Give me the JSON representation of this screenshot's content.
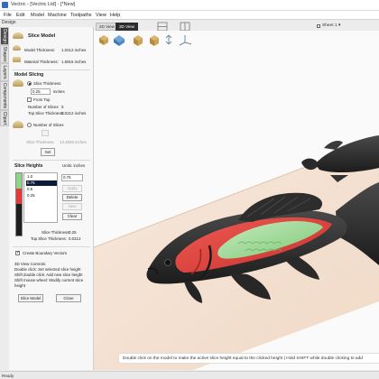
{
  "window": {
    "title": "Vectric - [Vectric Ltd] - [*New]"
  },
  "menu": [
    "File",
    "Edit",
    "Model",
    "Machine",
    "Toolpaths",
    "View",
    "Help"
  ],
  "panel_label": "Design",
  "side_tabs": [
    "Design",
    "Shapes",
    "Layers",
    "Components",
    "Clipart"
  ],
  "slice_model": {
    "heading": "Slice Model",
    "model_thickness_label": "Model Thickness:",
    "model_thickness_value": "1.0212 inches",
    "material_thickness_label": "Material Thickness:",
    "material_thickness_value": "1.5915 inches"
  },
  "model_slicing": {
    "heading": "Model Slicing",
    "slice_thickness_label": "Slice Thickness",
    "slice_thickness_value": "0.25",
    "slice_thickness_unit": "inches",
    "from_top_label": "From Top",
    "number_of_slices_label": "Number of Slices:",
    "number_of_slices_value": "5",
    "top_slice_thickness_label": "Top Slice Thickness:",
    "top_slice_thickness_value": "0.0212 inches",
    "number_of_slices_option": "Number of Slices",
    "slice_thickness_readout_label": "Slice Thickness:",
    "slice_thickness_readout_value": "12.2949 inches",
    "set_button": "Set"
  },
  "slice_heights": {
    "heading": "Slice Heights",
    "units_label": "Units: inches",
    "values": [
      "1.0",
      "0.75",
      "0.5",
      "0.25"
    ],
    "selected_index": 1,
    "edit_value": "0.75",
    "apply_button": "Apply",
    "delete_button": "Delete",
    "new_button": "New",
    "clear_button": "Clear",
    "slice_thickness_label": "Slice Thickness:",
    "slice_thickness_value": "0.25",
    "top_slice_thickness_label": "Top Slice Thickness:",
    "top_slice_thickness_value": "0.0212",
    "bar_colors": [
      "#8ed38e",
      "#e23a3a",
      "#1f1f1f",
      "#1f1f1f"
    ]
  },
  "boundary": {
    "label": "Create Boundary Vectors",
    "checked": true
  },
  "help_text": [
    "3D View Controls:",
    "Double click: Set selected slice height",
    "Shift double click: Add new slice height",
    "Shift mouse wheel: Modify current slice",
    "height"
  ],
  "footer_buttons": {
    "slice_model": "Slice Model",
    "close": "Close"
  },
  "view_tabs": [
    {
      "label": "2D View",
      "active": false
    },
    {
      "label": "3D View",
      "active": true
    }
  ],
  "sheet": {
    "label": "Sheet 1",
    "chevron": "▾"
  },
  "toolbar_icons": [
    "iso-view-icon",
    "top-view-icon",
    "front-view-icon",
    "side-view-icon",
    "zoom-fit-icon",
    "axis-icon"
  ],
  "viewport": {
    "background": "#fafafa",
    "board_color": "#f0d9c8",
    "fish_dark": "#2b2b2b",
    "fish_red": "#e0413c",
    "fish_green": "#a6dc9c"
  },
  "hint": "Double click on the model to make the active slice height equal to the clicked height | Hold SHIFT while double clicking to add",
  "status": "Ready"
}
